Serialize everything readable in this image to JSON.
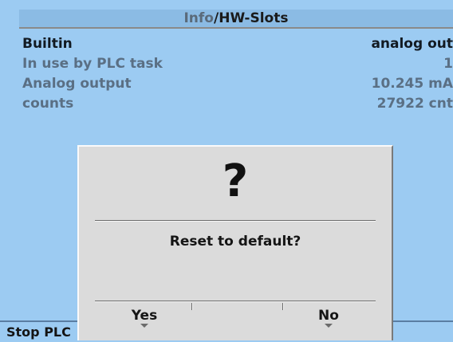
{
  "header": {
    "breadcrumb_parent": "Info",
    "separator": "/",
    "current": "HW-Slots"
  },
  "info_rows": [
    {
      "label": "Builtin",
      "value": "analog out"
    },
    {
      "label": "In use by PLC task",
      "value": "1"
    },
    {
      "label": "Analog output",
      "value": "10.245 mA"
    },
    {
      "label": "counts",
      "value": "27922 cnt"
    }
  ],
  "status_bar": {
    "text": "Stop PLC"
  },
  "dialog": {
    "icon": "?",
    "message": "Reset to default?",
    "yes_label": "Yes",
    "no_label": "No"
  },
  "colors": {
    "screen_background": "#9ccbf2",
    "title_background": "#8bbbe4",
    "dialog_background": "#dbdbdb",
    "muted_text": "#5a6f84",
    "dark_text": "#121a22"
  },
  "icons": {
    "dialog_icon": "question-mark-icon",
    "softkey_indicator": "caret-down-icon"
  }
}
